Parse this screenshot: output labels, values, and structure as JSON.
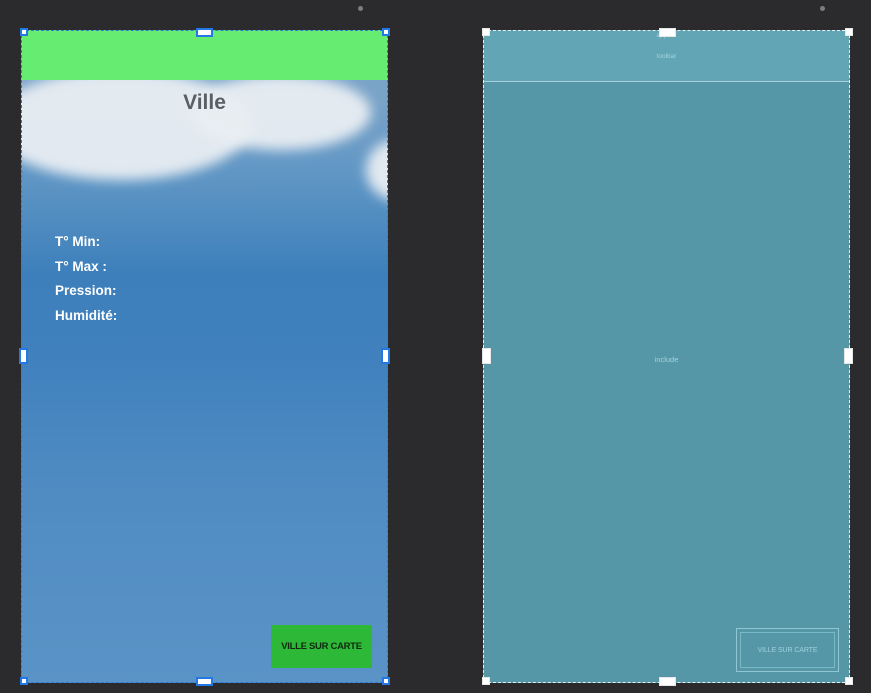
{
  "design_preview": {
    "title": "Ville",
    "labels": [
      "T° Min:",
      "T° Max :",
      "Pression:",
      "Humidité:"
    ],
    "map_button_label": "VILLE SUR CARTE"
  },
  "blueprint": {
    "appbar_label": "appbar",
    "toolbar_label": "toolbar",
    "include_label": "include",
    "map_button_label": "VILLE SUR CARTE"
  },
  "colors": {
    "canvas": "#2b2b2d",
    "toolbar_green": "#67ec72",
    "button_green": "#2db837",
    "selection_blue": "#2478e3",
    "blueprint_teal": "#5596a7"
  }
}
